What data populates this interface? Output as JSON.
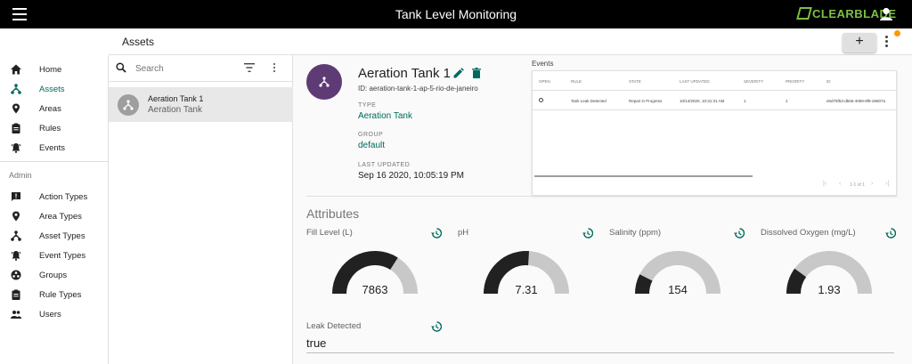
{
  "header": {
    "title": "Tank Level Monitoring",
    "brand": "CLEARBLADE",
    "brand_color": "#7cc142"
  },
  "page": {
    "title": "Assets",
    "add_label": "+"
  },
  "sidebar": {
    "items": [
      {
        "label": "Home",
        "icon": "home-icon"
      },
      {
        "label": "Assets",
        "icon": "asset-icon",
        "active": true
      },
      {
        "label": "Areas",
        "icon": "place-icon"
      },
      {
        "label": "Rules",
        "icon": "clipboard-icon"
      },
      {
        "label": "Events",
        "icon": "bell-icon"
      }
    ],
    "admin_heading": "Admin",
    "admin_items": [
      {
        "label": "Action Types",
        "icon": "feedback-icon"
      },
      {
        "label": "Area Types",
        "icon": "place-icon"
      },
      {
        "label": "Asset Types",
        "icon": "asset-icon"
      },
      {
        "label": "Event Types",
        "icon": "bell-icon"
      },
      {
        "label": "Groups",
        "icon": "groups-icon"
      },
      {
        "label": "Rule Types",
        "icon": "clipboard-icon"
      },
      {
        "label": "Users",
        "icon": "people-icon"
      }
    ]
  },
  "search": {
    "placeholder": "Search"
  },
  "asset_list": [
    {
      "name": "Aeration Tank 1",
      "type": "Aeration Tank"
    }
  ],
  "asset": {
    "name": "Aeration Tank 1",
    "id": "ID: aeration-tank-1-ap-5-rio-de-janeiro",
    "type_label": "TYPE",
    "type": "Aeration Tank",
    "group_label": "GROUP",
    "group": "default",
    "updated_label": "LAST UPDATED",
    "updated": "Sep 16 2020, 10:05:19 PM"
  },
  "events": {
    "title": "Events",
    "columns": [
      "OPEN",
      "RULE",
      "STATE",
      "LAST UPDATED",
      "SEVERITY",
      "PRIORITY",
      "ID"
    ],
    "rows": [
      {
        "rule": "Tank Leak Detected",
        "state": "Repair in Progress",
        "last_updated": "10/14/2020, 10:31:31 AM",
        "severity": "1",
        "priority": "1",
        "id": "ebd75f53-db66-4059-8f8-26807a"
      }
    ],
    "pager": "1-1 of 1"
  },
  "attributes": {
    "title": "Attributes",
    "gauges": [
      {
        "label": "Fill Level (L)",
        "value": "7863",
        "fraction": 0.68
      },
      {
        "label": "pH",
        "value": "7.31",
        "fraction": 0.52
      },
      {
        "label": "Salinity (ppm)",
        "value": "154",
        "fraction": 0.15
      },
      {
        "label": "Dissolved Oxygen (mg/L)",
        "value": "1.93",
        "fraction": 0.2
      }
    ],
    "leak_label": "Leak Detected",
    "leak_value": "true"
  },
  "colors": {
    "accent": "#00695c",
    "avatar": "#5e3b75",
    "gauge_fill": "#212121",
    "gauge_track": "#c8c8c8",
    "topbar": "#000000",
    "notification": "#ff9800"
  }
}
